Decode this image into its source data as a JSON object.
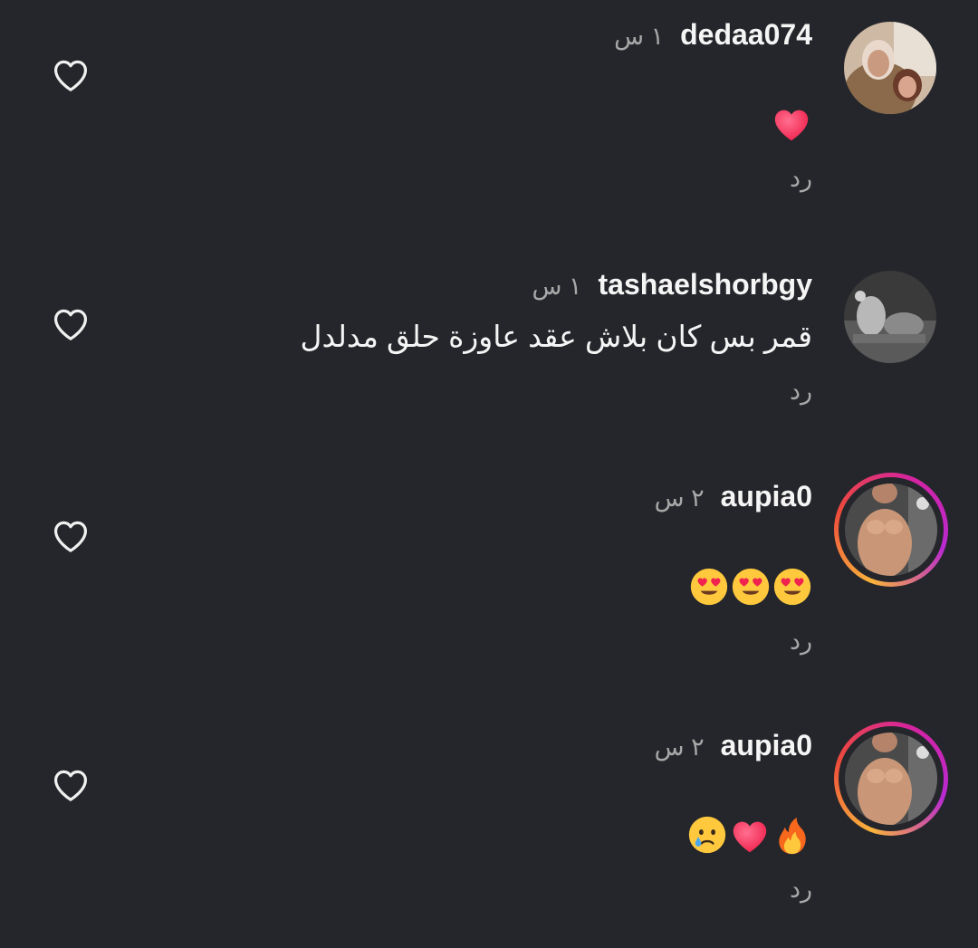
{
  "comments": [
    {
      "username": "dedaa074",
      "time": "١ س",
      "text": "",
      "emojis": [
        "red-heart"
      ],
      "reply_label": "رد",
      "avatar_ring": false
    },
    {
      "username": "tashaelshorbgy",
      "time": "١ س",
      "text": "قمر بس كان بلاش عقد عاوزة حلق مدلدل",
      "emojis": [],
      "reply_label": "رد",
      "avatar_ring": false
    },
    {
      "username": "aupia0",
      "time": "٢ س",
      "text": "",
      "emojis": [
        "heart-eyes",
        "heart-eyes",
        "heart-eyes"
      ],
      "reply_label": "رد",
      "avatar_ring": true
    },
    {
      "username": "aupia0",
      "time": "٢ س",
      "text": "",
      "emojis": [
        "fire",
        "red-heart",
        "crying-face"
      ],
      "reply_label": "رد",
      "avatar_ring": true
    }
  ],
  "icons": {
    "like": "heart-outline-icon"
  },
  "colors": {
    "background": "#25262b",
    "text": "#f5f5f5",
    "muted": "#a8a8a8",
    "heart": "#ff2d55"
  }
}
